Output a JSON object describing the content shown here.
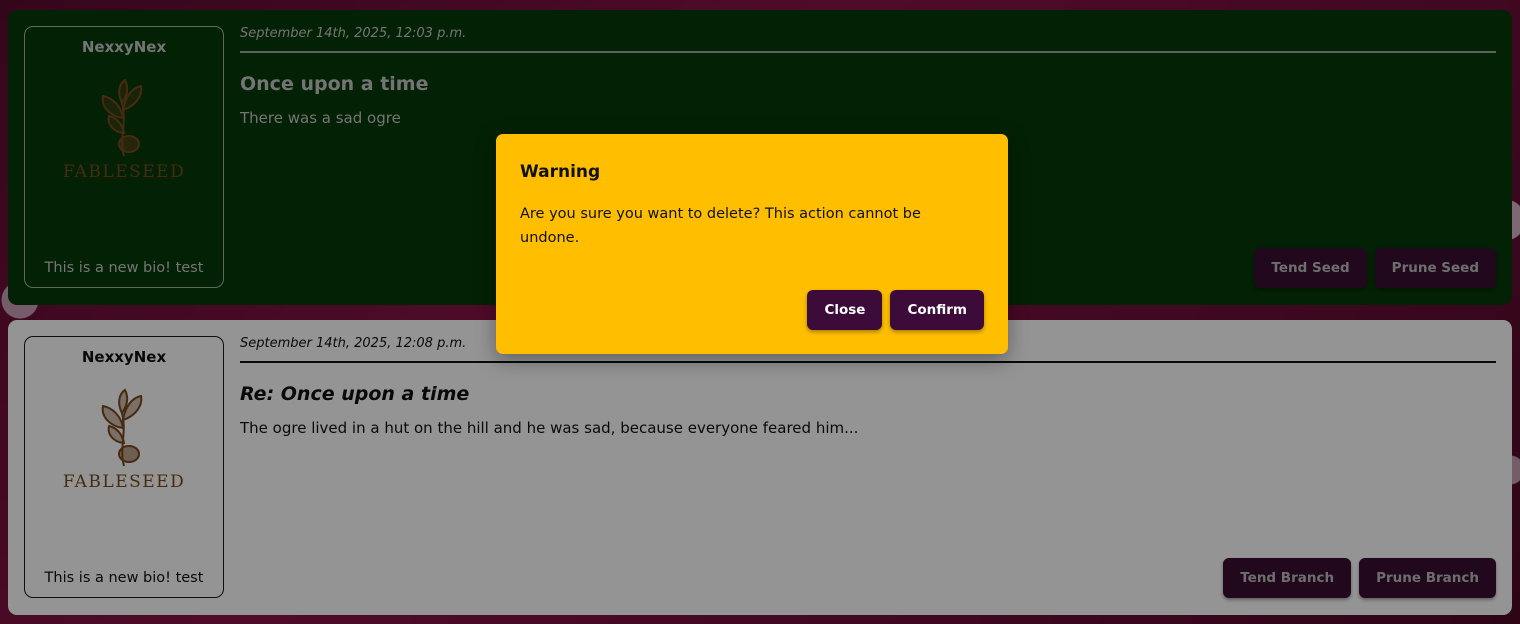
{
  "posts": [
    {
      "author": "NexxyNex",
      "logo_text": "FABLESEED",
      "bio": "This is a new bio! test",
      "timestamp": "September 14th, 2025, 12:03 p.m.",
      "title": "Once upon a time",
      "body": "There was a sad ogre",
      "actions": [
        "Tend Seed",
        "Prune Seed"
      ]
    },
    {
      "author": "NexxyNex",
      "logo_text": "FABLESEED",
      "bio": "This is a new bio! test",
      "timestamp": "September 14th, 2025, 12:08 p.m.",
      "title": "Re: Once upon a time",
      "body": "The ogre lived in a hut on the hill and he was sad, because everyone feared him...",
      "actions": [
        "Tend Branch",
        "Prune Branch"
      ]
    }
  ],
  "modal": {
    "title": "Warning",
    "message": "Are you sure you want to delete? This action cannot be undone.",
    "close_label": "Close",
    "confirm_label": "Confirm"
  },
  "colors": {
    "seed_background": "#063a08",
    "branch_background": "#ffffff",
    "button_background": "#3b0f33",
    "modal_background": "#ffbf00",
    "page_background": "#7a0f3e"
  },
  "icons": {
    "logo": "fableseed-sprout-seed-logo"
  }
}
